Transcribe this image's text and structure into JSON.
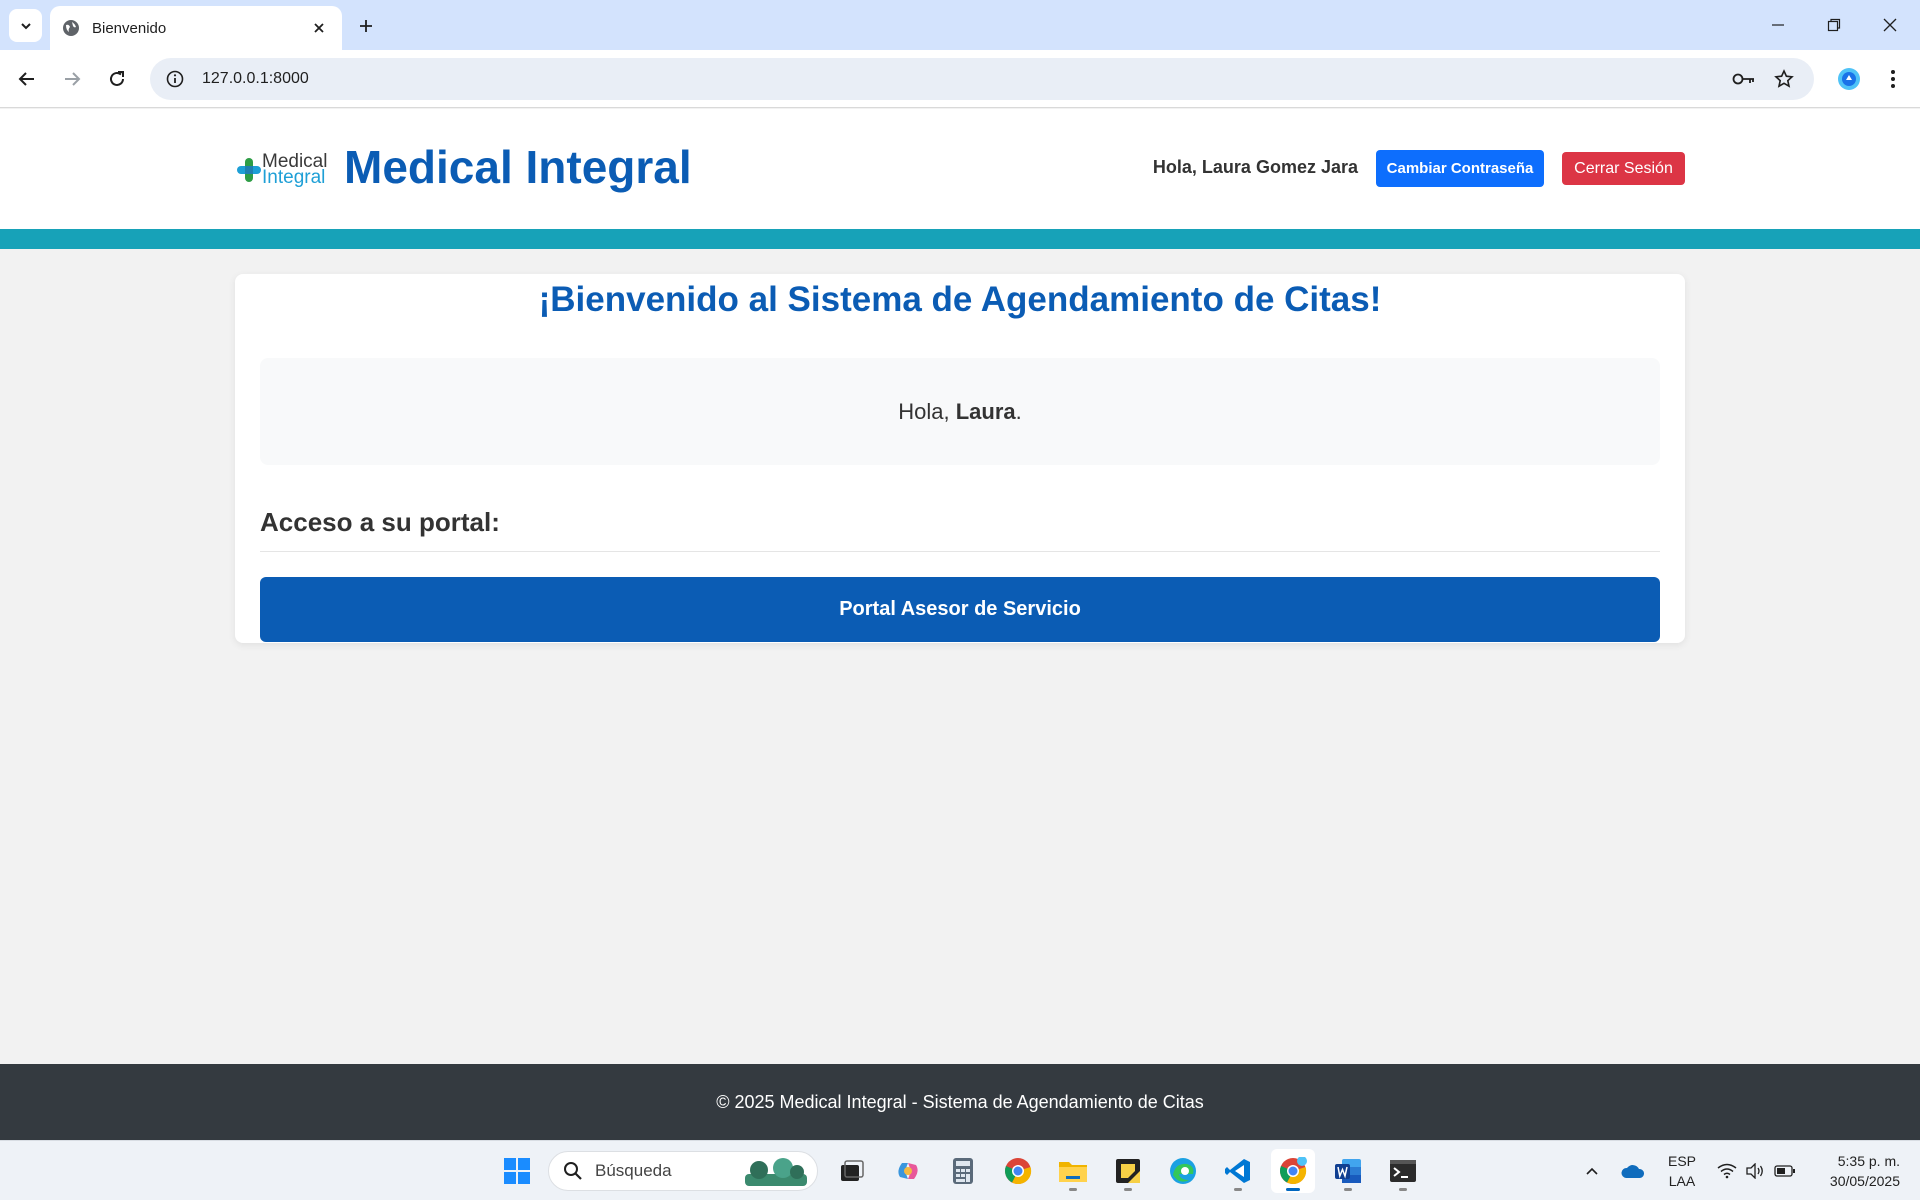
{
  "browser": {
    "tab_title": "Bienvenido",
    "url": "127.0.0.1:8000"
  },
  "header": {
    "logo_line1": "Medical",
    "logo_line2": "Integral",
    "brand": "Medical Integral",
    "greeting": "Hola, Laura Gomez Jara",
    "change_password": "Cambiar Contraseña",
    "logout": "Cerrar Sesión"
  },
  "main": {
    "title": "¡Bienvenido al Sistema de Agendamiento de Citas!",
    "hello_prefix": "Hola, ",
    "hello_name": "Laura",
    "hello_suffix": ".",
    "section_title": "Acceso a su portal:",
    "portal_button": "Portal Asesor de Servicio"
  },
  "footer": {
    "text": "© 2025 Medical Integral - Sistema de Agendamiento de Citas"
  },
  "taskbar": {
    "search_placeholder": "Búsqueda",
    "lang_line1": "ESP",
    "lang_line2": "LAA",
    "time": "5:35 p. m.",
    "date": "30/05/2025"
  },
  "colors": {
    "brand_blue": "#0b5cb4",
    "teal": "#17a2b8",
    "primary": "#0d6efd",
    "danger": "#dc3545",
    "footer": "#343a40"
  }
}
